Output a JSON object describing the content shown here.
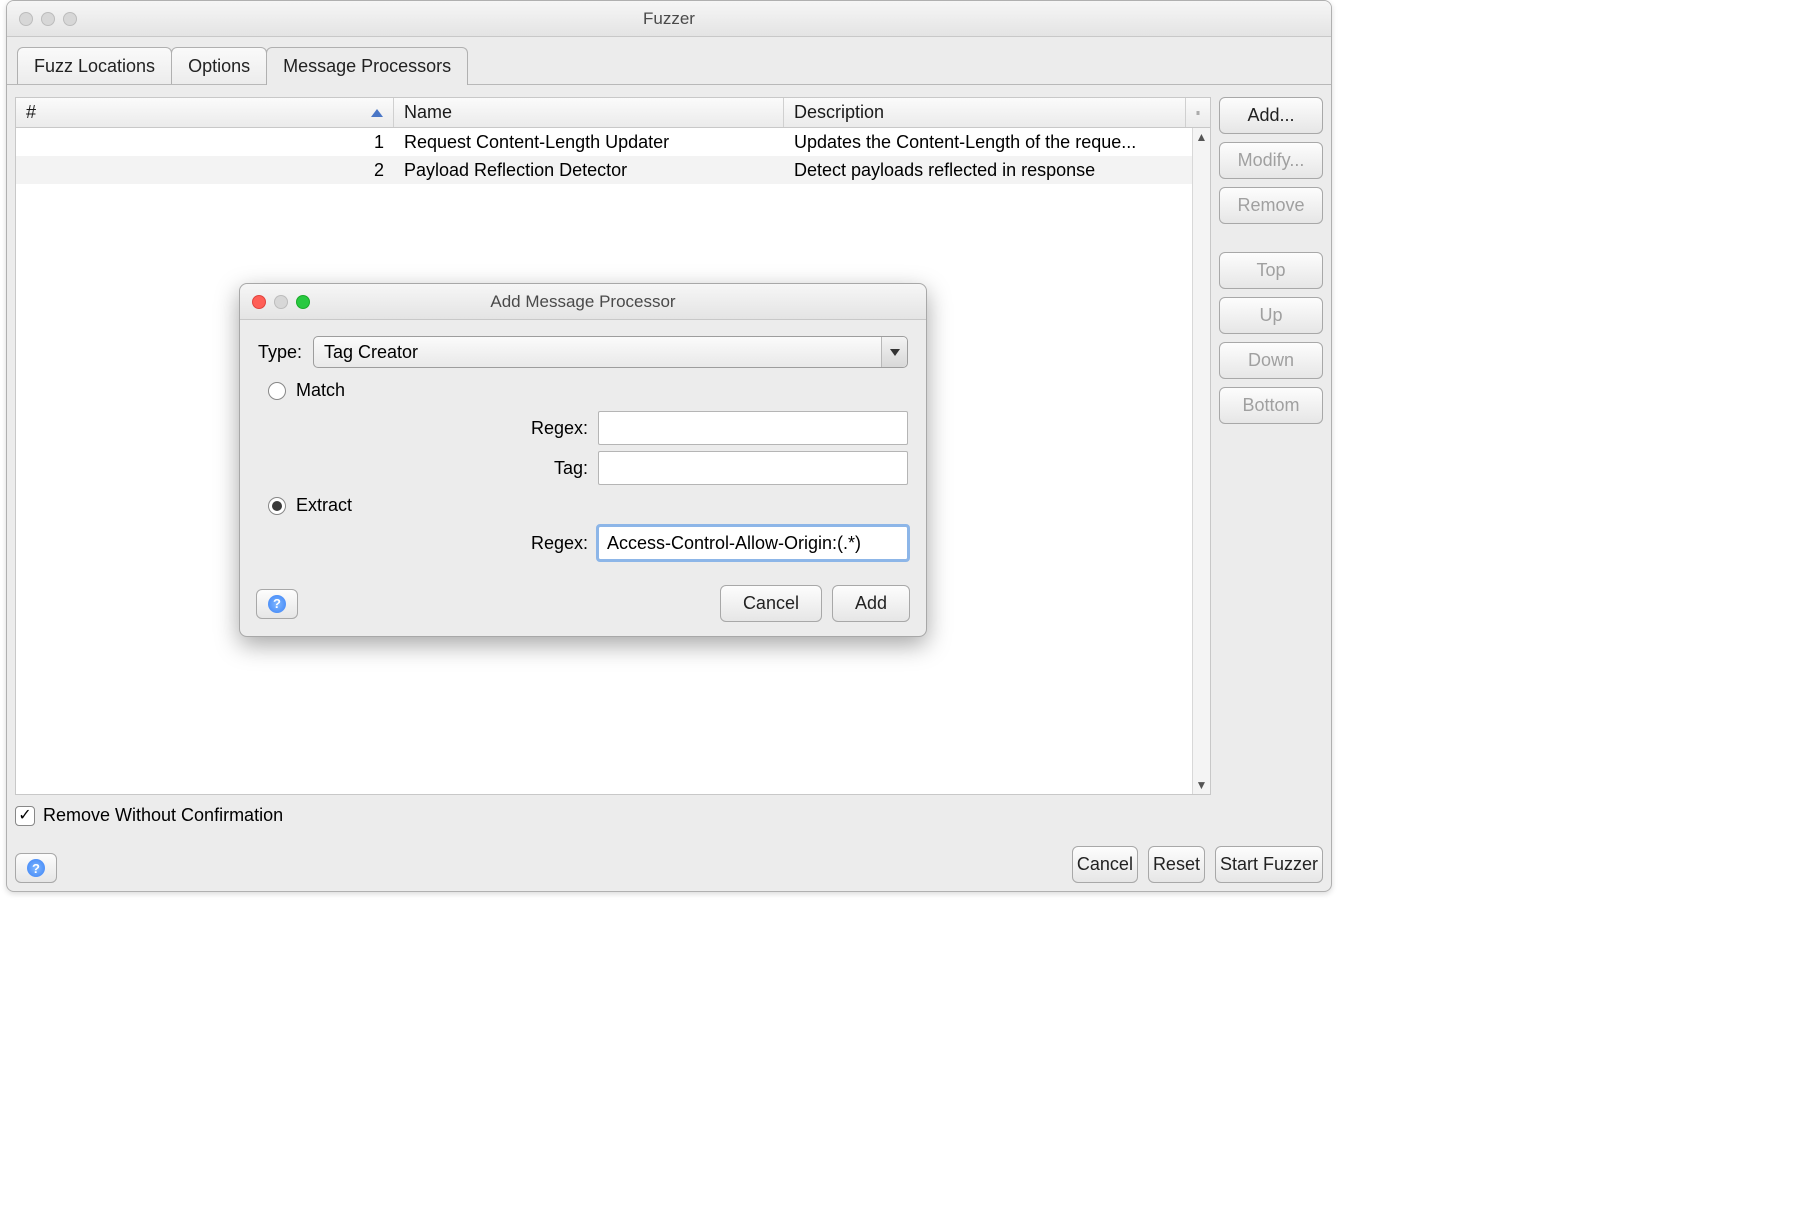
{
  "window": {
    "title": "Fuzzer"
  },
  "tabs": [
    {
      "label": "Fuzz Locations"
    },
    {
      "label": "Options"
    },
    {
      "label": "Message Processors"
    }
  ],
  "table": {
    "headers": {
      "num": "#",
      "name": "Name",
      "desc": "Description"
    },
    "rows": [
      {
        "num": "1",
        "name": "Request Content-Length Updater",
        "desc": "Updates the Content-Length of the reque..."
      },
      {
        "num": "2",
        "name": "Payload Reflection Detector",
        "desc": "Detect payloads reflected in response"
      }
    ]
  },
  "side_buttons": {
    "add": "Add...",
    "modify": "Modify...",
    "remove": "Remove",
    "top": "Top",
    "up": "Up",
    "down": "Down",
    "bottom": "Bottom"
  },
  "checkbox": {
    "label": "Remove Without Confirmation"
  },
  "bottom_buttons": {
    "cancel": "Cancel",
    "reset": "Reset",
    "start": "Start Fuzzer"
  },
  "modal": {
    "title": "Add Message Processor",
    "type_label": "Type:",
    "type_value": "Tag Creator",
    "match_label": "Match",
    "extract_label": "Extract",
    "match_regex_label": "Regex:",
    "match_regex_value": "",
    "match_tag_label": "Tag:",
    "match_tag_value": "",
    "extract_regex_label": "Regex:",
    "extract_regex_value": "Access-Control-Allow-Origin:(.*)",
    "buttons": {
      "cancel": "Cancel",
      "add": "Add"
    }
  }
}
